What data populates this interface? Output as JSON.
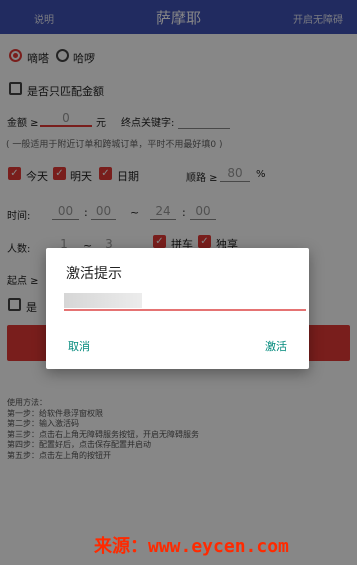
{
  "app": {
    "left_link": "说明",
    "title": "萨摩耶",
    "right_link": "开启无障碍"
  },
  "platform": {
    "option1": "嘀嗒",
    "option2": "哈啰",
    "selected": "嘀嗒"
  },
  "match_amount_only_label": "是否只匹配金额",
  "amount": {
    "label": "金额 ≥",
    "value": "0",
    "unit": "元",
    "endpoint_label": "终点关键字:"
  },
  "hint_text": "( 一般适用于附近订单和跨城订单，平时不用最好填0 )",
  "days": {
    "today": "今天",
    "tomorrow": "明天",
    "date": "日期",
    "route_label": "顺路 ≥",
    "route_value": "80",
    "route_unit": "%"
  },
  "time": {
    "label": "时间:",
    "start_h": "00",
    "start_m": "00",
    "sep": "~",
    "end_h": "24",
    "end_m": "00"
  },
  "people": {
    "label": "人数:",
    "min": "1",
    "sep": "~",
    "max": "3",
    "carpool": "拼车",
    "exclusive": "独享"
  },
  "partial": {
    "start_label": "起点 ≥",
    "checkbox_label": "是"
  },
  "instructions": [
    "使用方法：",
    "第一步：给软件悬浮窗权限",
    "第二步：输入激活码",
    "第三步：点击右上角无障碍服务按钮，开启无障碍服务",
    "第四步：配置好后，点击保存配置并启动",
    "第五步：点击左上角的按钮开"
  ],
  "dialog": {
    "title": "激活提示",
    "cancel": "取消",
    "activate": "激活"
  },
  "watermark": "来源：www.eycen.com",
  "colors": {
    "primary": "#3f51b5",
    "accent": "#e53935",
    "dialog_button": "#00897b"
  }
}
